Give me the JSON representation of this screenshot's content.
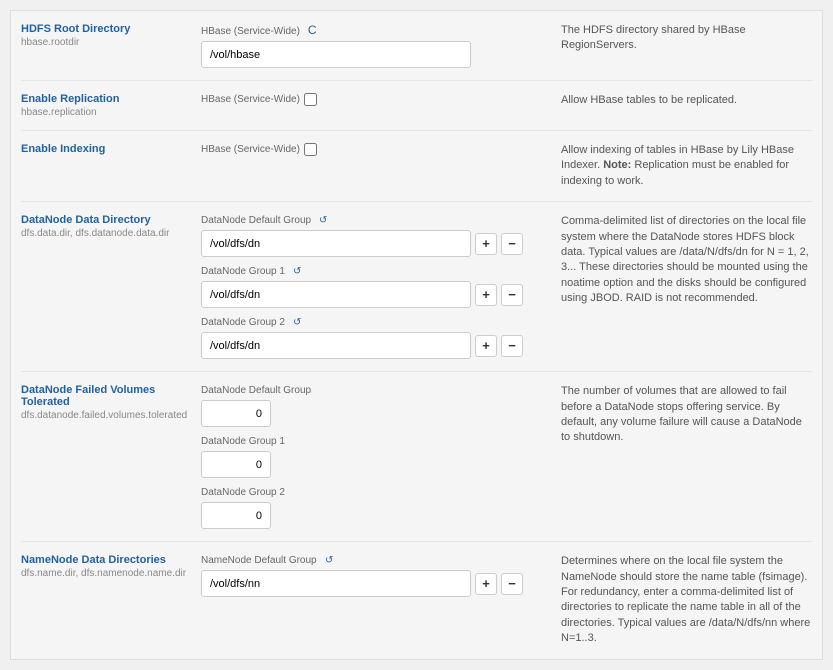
{
  "settings": [
    {
      "title": "HDFS Root Directory",
      "sub": "hbase.rootdir",
      "desc": "The HDFS directory shared by HBase RegionServers.",
      "groups": [
        {
          "scope": "HBase (Service-Wide)",
          "type": "text",
          "value": "/vol/hbase",
          "reset": true
        }
      ]
    },
    {
      "title": "Enable Replication",
      "sub": "hbase.replication",
      "desc": "Allow HBase tables to be replicated.",
      "groups": [
        {
          "scope": "HBase (Service-Wide)",
          "type": "check"
        }
      ]
    },
    {
      "title": "Enable Indexing",
      "sub": "",
      "desc": "Allow indexing of tables in HBase by Lily HBase Indexer. ",
      "note_label": "Note:",
      "note_text": " Replication must be enabled for indexing to work.",
      "groups": [
        {
          "scope": "HBase (Service-Wide)",
          "type": "check"
        }
      ]
    },
    {
      "title": "DataNode Data Directory",
      "sub": "dfs.data.dir, dfs.datanode.data.dir",
      "desc": "Comma-delimited list of directories on the local file system where the DataNode stores HDFS block data. Typical values are /data/N/dfs/dn for N = 1, 2, 3... These directories should be mounted using the noatime option and the disks should be configured using JBOD. RAID is not recommended.",
      "groups": [
        {
          "scope": "DataNode Default Group",
          "type": "text",
          "value": "/vol/dfs/dn",
          "undo": true,
          "pm": true
        },
        {
          "scope": "DataNode Group 1",
          "type": "text",
          "value": "/vol/dfs/dn",
          "undo": true,
          "pm": true
        },
        {
          "scope": "DataNode Group 2",
          "type": "text",
          "value": "/vol/dfs/dn",
          "undo": true,
          "pm": true
        }
      ]
    },
    {
      "title": "DataNode Failed Volumes Tolerated",
      "sub": "dfs.datanode.failed.volumes.tolerated",
      "desc": "The number of volumes that are allowed to fail before a DataNode stops offering service. By default, any volume failure will cause a DataNode to shutdown.",
      "groups": [
        {
          "scope": "DataNode Default Group",
          "type": "num",
          "value": "0"
        },
        {
          "scope": "DataNode Group 1",
          "type": "num",
          "value": "0"
        },
        {
          "scope": "DataNode Group 2",
          "type": "num",
          "value": "0"
        }
      ]
    },
    {
      "title": "NameNode Data Directories",
      "sub": "dfs.name.dir, dfs.namenode.name.dir",
      "desc": "Determines where on the local file system the NameNode should store the name table (fsimage). For redundancy, enter a comma-delimited list of directories to replicate the name table in all of the directories. Typical values are /data/N/dfs/nn where N=1..3.",
      "groups": [
        {
          "scope": "NameNode Default Group",
          "type": "text",
          "value": "/vol/dfs/nn",
          "undo": true,
          "pm": true
        }
      ]
    }
  ],
  "buttons": {
    "plus": "+",
    "minus": "−"
  }
}
